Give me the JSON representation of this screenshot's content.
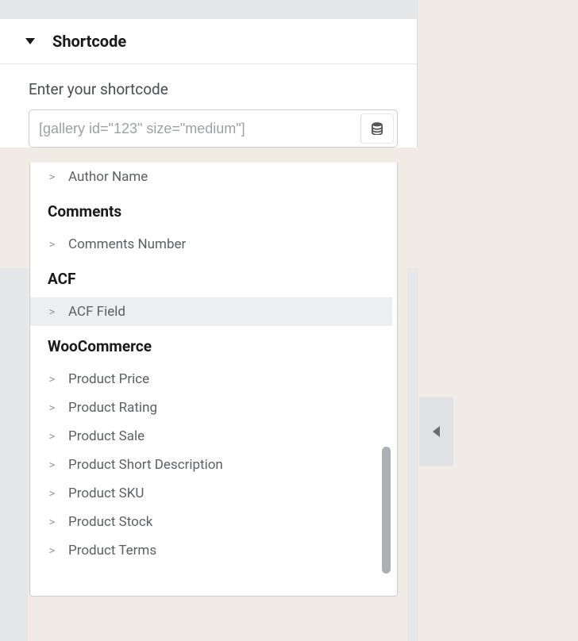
{
  "panel": {
    "title": "Shortcode"
  },
  "field": {
    "label": "Enter your shortcode",
    "placeholder": "[gallery id=\"123\" size=\"medium\"]"
  },
  "dropdown": {
    "items": [
      {
        "type": "item",
        "label": "Author Name",
        "highlighted": false
      },
      {
        "type": "group",
        "label": "Comments"
      },
      {
        "type": "item",
        "label": "Comments Number",
        "highlighted": false
      },
      {
        "type": "group",
        "label": "ACF"
      },
      {
        "type": "item",
        "label": "ACF Field",
        "highlighted": true
      },
      {
        "type": "group",
        "label": "WooCommerce"
      },
      {
        "type": "item",
        "label": "Product Price",
        "highlighted": false
      },
      {
        "type": "item",
        "label": "Product Rating",
        "highlighted": false
      },
      {
        "type": "item",
        "label": "Product Sale",
        "highlighted": false
      },
      {
        "type": "item",
        "label": "Product Short Description",
        "highlighted": false
      },
      {
        "type": "item",
        "label": "Product SKU",
        "highlighted": false
      },
      {
        "type": "item",
        "label": "Product Stock",
        "highlighted": false
      },
      {
        "type": "item",
        "label": "Product Terms",
        "highlighted": false
      }
    ]
  }
}
